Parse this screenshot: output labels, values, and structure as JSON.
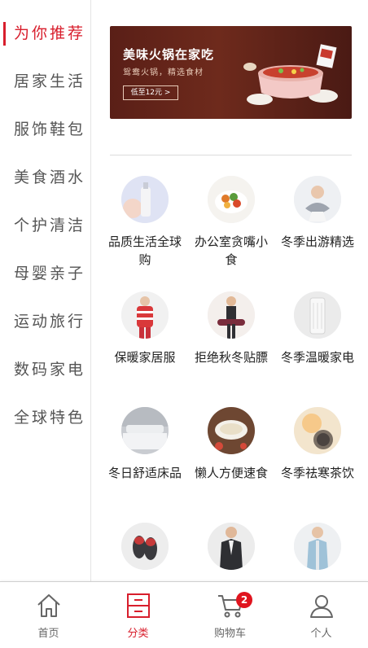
{
  "sidebar": {
    "items": [
      {
        "label": "为你推荐",
        "active": true
      },
      {
        "label": "居家生活",
        "active": false
      },
      {
        "label": "服饰鞋包",
        "active": false
      },
      {
        "label": "美食酒水",
        "active": false
      },
      {
        "label": "个护清洁",
        "active": false
      },
      {
        "label": "母婴亲子",
        "active": false
      },
      {
        "label": "运动旅行",
        "active": false
      },
      {
        "label": "数码家电",
        "active": false
      },
      {
        "label": "全球特色",
        "active": false
      }
    ]
  },
  "banner": {
    "title": "美味火锅在家吃",
    "subtitle": "鸳鸯火锅，精选食材",
    "button": "低至12元 >"
  },
  "categories": [
    {
      "label": "品质生活全球购",
      "icon": "bottle-icon"
    },
    {
      "label": "办公室贪嘴小食",
      "icon": "snack-bowl-icon"
    },
    {
      "label": "冬季出游精选",
      "icon": "neck-pillow-icon"
    },
    {
      "label": "保暖家居服",
      "icon": "sweater-icon"
    },
    {
      "label": "拒绝秋冬贴膘",
      "icon": "yoga-mat-icon"
    },
    {
      "label": "冬季温暖家电",
      "icon": "heater-icon"
    },
    {
      "label": "冬日舒适床品",
      "icon": "bedding-icon"
    },
    {
      "label": "懒人方便速食",
      "icon": "noodle-icon"
    },
    {
      "label": "冬季祛寒茶饮",
      "icon": "tea-icon"
    },
    {
      "label": "",
      "icon": "slippers-icon"
    },
    {
      "label": "",
      "icon": "men-coat-icon"
    },
    {
      "label": "",
      "icon": "women-coat-icon"
    }
  ],
  "tabbar": {
    "tabs": [
      {
        "label": "首页",
        "icon": "home-icon",
        "active": false
      },
      {
        "label": "分类",
        "icon": "category-icon",
        "active": true
      },
      {
        "label": "购物车",
        "icon": "cart-icon",
        "active": false
      },
      {
        "label": "个人",
        "icon": "user-icon",
        "active": false
      }
    ],
    "cart_badge": "2"
  },
  "colors": {
    "accent": "#d81e2c",
    "text": "#222222",
    "muted": "#666666"
  }
}
